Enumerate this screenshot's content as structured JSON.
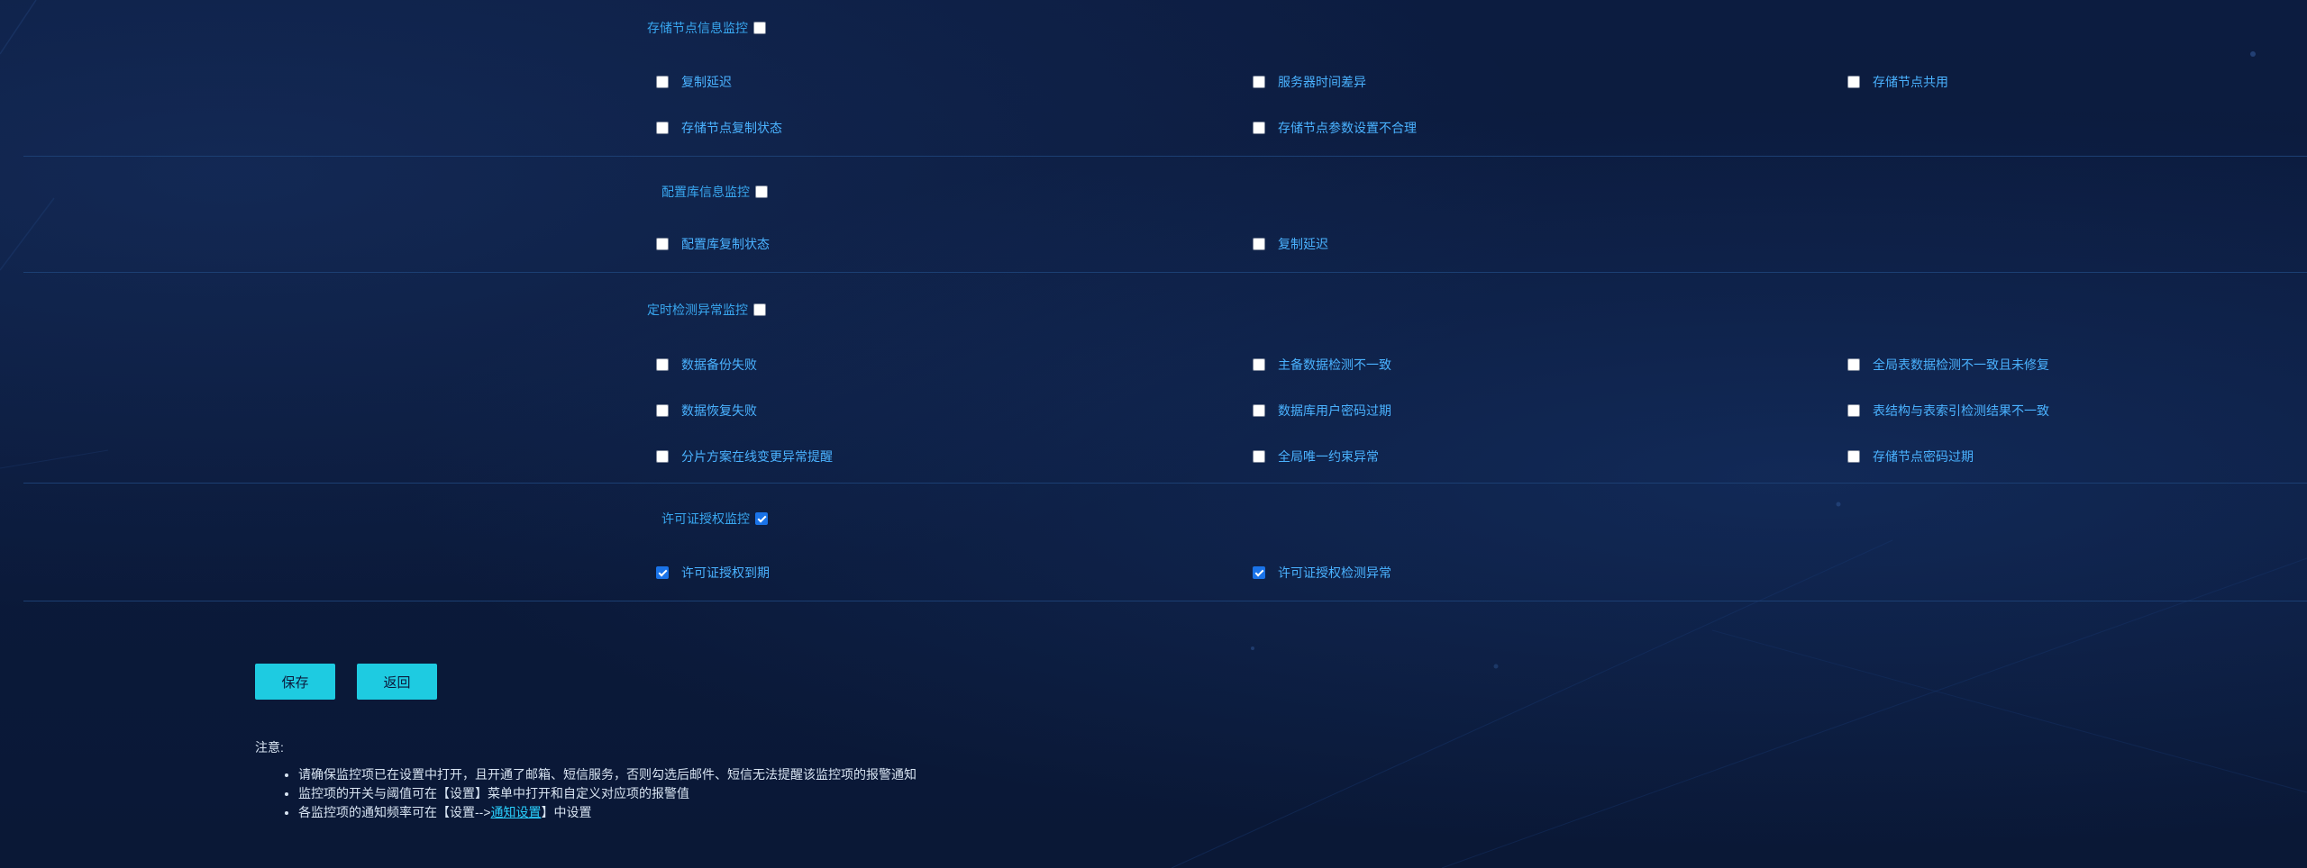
{
  "sections": [
    {
      "title": "存储节点信息监控",
      "checked": false,
      "items": [
        {
          "label": "复制延迟",
          "checked": false
        },
        {
          "label": "服务器时间差异",
          "checked": false
        },
        {
          "label": "存储节点共用",
          "checked": false
        },
        {
          "label": "存储节点复制状态",
          "checked": false
        },
        {
          "label": "存储节点参数设置不合理",
          "checked": false
        }
      ]
    },
    {
      "title": "配置库信息监控",
      "checked": false,
      "items": [
        {
          "label": "配置库复制状态",
          "checked": false
        },
        {
          "label": "复制延迟",
          "checked": false
        }
      ]
    },
    {
      "title": "定时检测异常监控",
      "checked": false,
      "items": [
        {
          "label": "数据备份失败",
          "checked": false
        },
        {
          "label": "主备数据检测不一致",
          "checked": false
        },
        {
          "label": "全局表数据检测不一致且未修复",
          "checked": false
        },
        {
          "label": "数据恢复失败",
          "checked": false
        },
        {
          "label": "数据库用户密码过期",
          "checked": false
        },
        {
          "label": "表结构与表索引检测结果不一致",
          "checked": false
        },
        {
          "label": "分片方案在线变更异常提醒",
          "checked": false
        },
        {
          "label": "全局唯一约束异常",
          "checked": false
        },
        {
          "label": "存储节点密码过期",
          "checked": false
        }
      ]
    },
    {
      "title": "许可证授权监控",
      "checked": true,
      "items": [
        {
          "label": "许可证授权到期",
          "checked": true
        },
        {
          "label": "许可证授权检测异常",
          "checked": true
        }
      ]
    }
  ],
  "buttons": {
    "save": "保存",
    "back": "返回"
  },
  "notes": {
    "title": "注意:",
    "line1": "请确保监控项已在设置中打开，且开通了邮箱、短信服务，否则勾选后邮件、短信无法提醒该监控项的报警通知",
    "line2": "监控项的开关与阈值可在【设置】菜单中打开和自定义对应项的报警值",
    "line3_prefix": "各监控项的通知频率可在【设置-->",
    "line3_link": "通知设置",
    "line3_suffix": "】中设置"
  },
  "colors": {
    "background": "#0b1a3c",
    "accent": "#1ecbe1",
    "label": "#4ab2ff",
    "checkbox_checked": "#1a73e8"
  }
}
